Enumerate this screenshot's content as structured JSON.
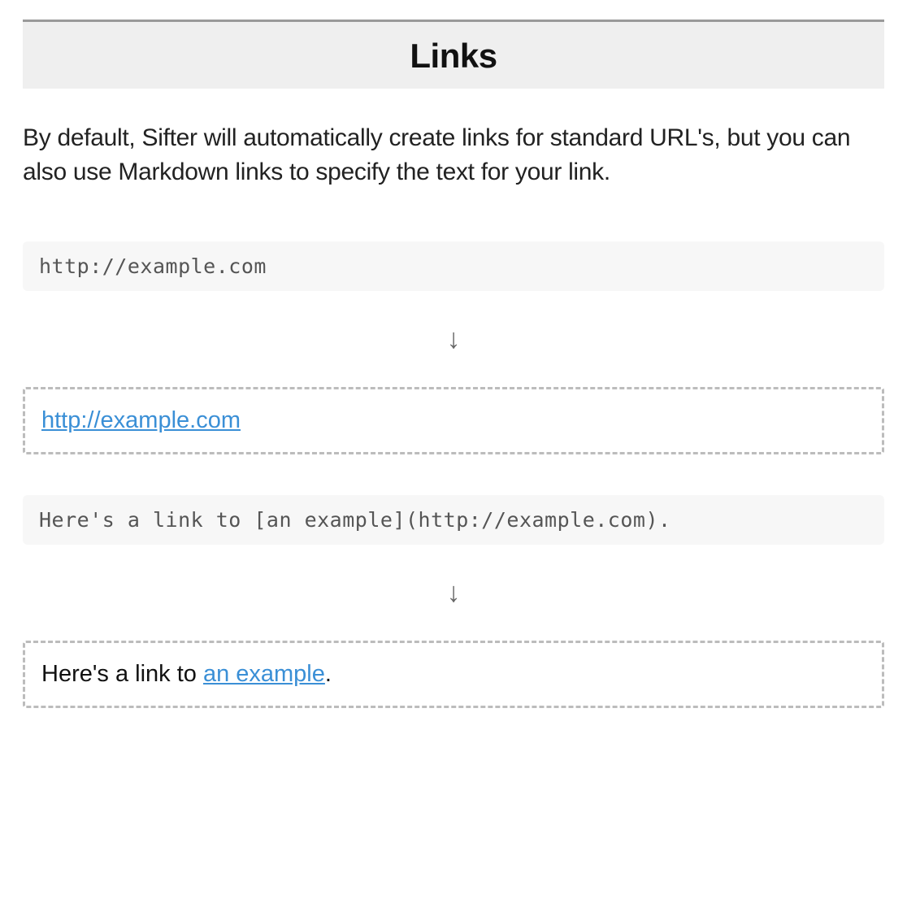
{
  "section": {
    "title": "Links",
    "intro": "By default, Sifter will automatically create links for standard URL's, but you can also use Markdown links to specify the text for your link."
  },
  "arrow_glyph": "↓",
  "examples": [
    {
      "code": "http://example.com",
      "output_prefix": "",
      "output_link_text": "http://example.com",
      "output_suffix": ""
    },
    {
      "code": "Here's a link to [an example](http://example.com).",
      "output_prefix": "Here's a link to ",
      "output_link_text": "an example",
      "output_suffix": "."
    }
  ]
}
